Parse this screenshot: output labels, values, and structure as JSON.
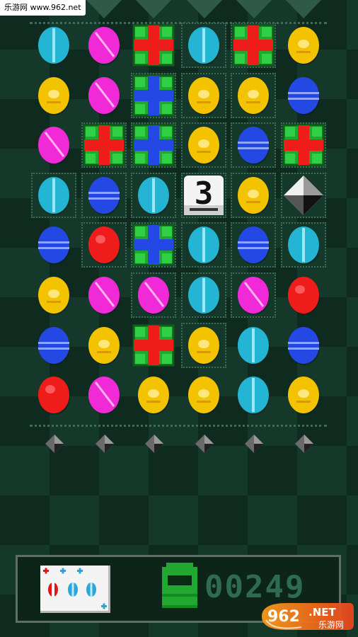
{
  "watermark": {
    "text": "乐游网 www.962.net"
  },
  "game": {
    "columns": 6,
    "rows": 8,
    "board": [
      [
        "cyan",
        "magenta",
        "red_gift",
        "cyan",
        "red_gift",
        "yellow"
      ],
      [
        "yellow",
        "magenta",
        "blue_gift",
        "yellow",
        "yellow",
        "blue"
      ],
      [
        "magenta",
        "red_gift",
        "blue_gift",
        "yellow",
        "blue",
        "red_gift"
      ],
      [
        "cyan",
        "blue",
        "cyan",
        "dice_3",
        "yellow",
        "diamond"
      ],
      [
        "blue",
        "red",
        "blue_gift",
        "cyan",
        "blue",
        "cyan"
      ],
      [
        "yellow",
        "magenta",
        "magenta",
        "cyan",
        "magenta",
        "red"
      ],
      [
        "blue",
        "yellow",
        "red_gift",
        "yellow",
        "cyan",
        "blue"
      ],
      [
        "red",
        "magenta",
        "yellow",
        "yellow",
        "cyan",
        "yellow"
      ]
    ],
    "highlighted": [
      [
        0,
        3
      ],
      [
        0,
        4
      ],
      [
        1,
        2
      ],
      [
        1,
        3
      ],
      [
        1,
        4
      ],
      [
        2,
        1
      ],
      [
        2,
        2
      ],
      [
        2,
        3
      ],
      [
        2,
        4
      ],
      [
        2,
        5
      ],
      [
        3,
        0
      ],
      [
        3,
        1
      ],
      [
        3,
        2
      ],
      [
        3,
        3
      ],
      [
        3,
        4
      ],
      [
        3,
        5
      ],
      [
        4,
        1
      ],
      [
        4,
        2
      ],
      [
        4,
        3
      ],
      [
        4,
        4
      ],
      [
        4,
        5
      ],
      [
        5,
        2
      ],
      [
        5,
        3
      ],
      [
        5,
        4
      ],
      [
        6,
        3
      ]
    ],
    "dice_value": "3",
    "mines_row_count": 6
  },
  "hud": {
    "score": "00249",
    "card_icon": "powerup-card-icon",
    "phone_icon": "green-phone-icon"
  },
  "logo": {
    "number": "962",
    "suffix": ".NET",
    "subtitle": "乐游网"
  },
  "colors": {
    "cyan": "#23b5d3",
    "magenta": "#ef2ad6",
    "yellow": "#f3c300",
    "blue": "#2448e3",
    "red": "#ef1c1c",
    "gift_green": "#22a830",
    "background_dark": "#0f2b1f",
    "background_light": "#14392a"
  }
}
